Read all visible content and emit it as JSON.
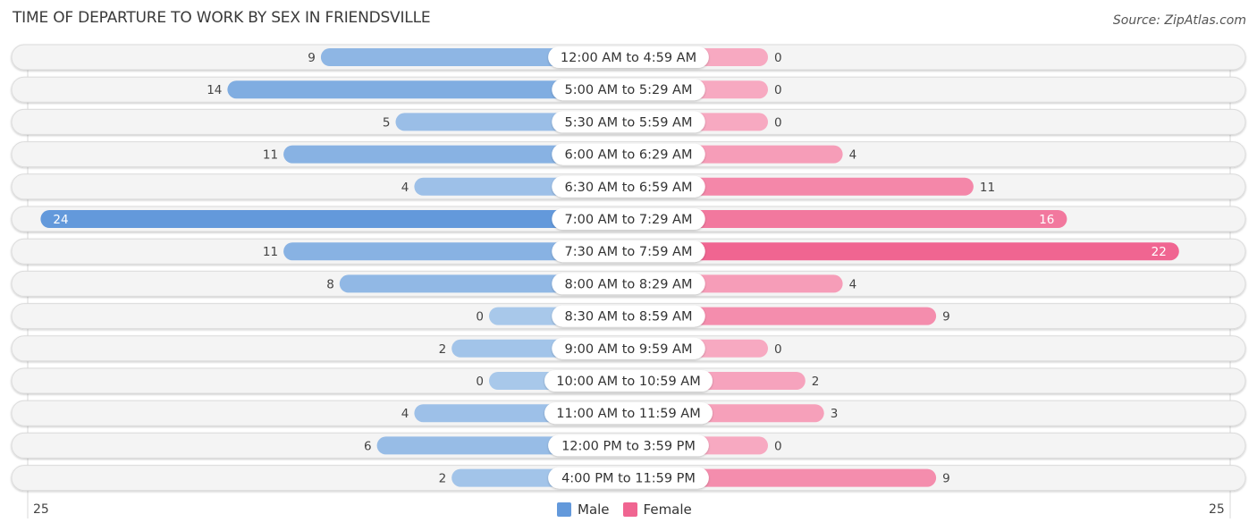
{
  "title": "TIME OF DEPARTURE TO WORK BY SEX IN FRIENDSVILLE",
  "source": "Source: ZipAtlas.com",
  "colors": {
    "male_strong": "#6399db",
    "male_light": "#a8c8ea",
    "female_strong": "#f06591",
    "female_light": "#f7a9c1",
    "row_bg": "#f4f4f4",
    "row_border": "#dcdcdc"
  },
  "legend": [
    {
      "label": "Male",
      "color": "#6399db"
    },
    {
      "label": "Female",
      "color": "#f06591"
    }
  ],
  "axis": {
    "left_label": "25",
    "right_label": "25"
  },
  "chart_data": {
    "type": "bar",
    "orientation": "horizontal-diverging",
    "title": "TIME OF DEPARTURE TO WORK BY SEX IN FRIENDSVILLE",
    "categories": [
      "12:00 AM to 4:59 AM",
      "5:00 AM to 5:29 AM",
      "5:30 AM to 5:59 AM",
      "6:00 AM to 6:29 AM",
      "6:30 AM to 6:59 AM",
      "7:00 AM to 7:29 AM",
      "7:30 AM to 7:59 AM",
      "8:00 AM to 8:29 AM",
      "8:30 AM to 8:59 AM",
      "9:00 AM to 9:59 AM",
      "10:00 AM to 10:59 AM",
      "11:00 AM to 11:59 AM",
      "12:00 PM to 3:59 PM",
      "4:00 PM to 11:59 PM"
    ],
    "series": [
      {
        "name": "Male",
        "values": [
          9,
          14,
          5,
          11,
          4,
          24,
          11,
          8,
          0,
          2,
          0,
          4,
          6,
          2
        ]
      },
      {
        "name": "Female",
        "values": [
          0,
          0,
          0,
          4,
          11,
          16,
          22,
          4,
          9,
          0,
          2,
          3,
          0,
          9
        ]
      }
    ],
    "xlim": [
      -25,
      25
    ],
    "tick_labels": [
      "25",
      "25"
    ],
    "legend_position": "bottom-center",
    "grid": false
  }
}
